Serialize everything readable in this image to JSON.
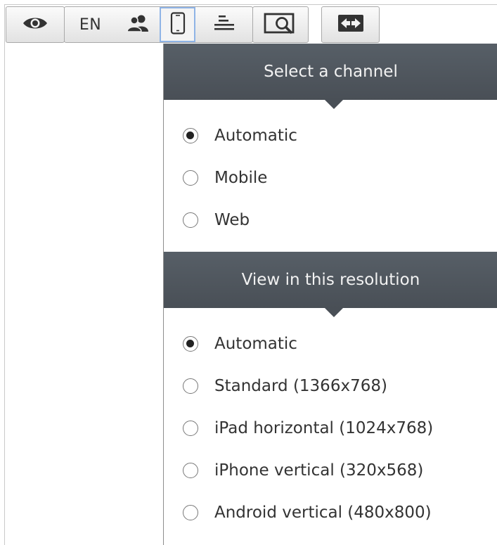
{
  "toolbar": {
    "language_label": "EN",
    "icons": [
      "eye-icon",
      "users-icon",
      "device-icon",
      "list-icon",
      "screen-zoom-icon",
      "resize-horizontal-icon"
    ],
    "active_button": "device-icon"
  },
  "channel_menu": {
    "header": "Select a channel",
    "options": [
      {
        "label": "Automatic",
        "checked": true
      },
      {
        "label": "Mobile",
        "checked": false
      },
      {
        "label": "Web",
        "checked": false
      }
    ]
  },
  "resolution_menu": {
    "header": "View in this resolution",
    "options": [
      {
        "label": "Automatic",
        "checked": true
      },
      {
        "label": "Standard (1366x768)",
        "checked": false
      },
      {
        "label": "iPad horizontal (1024x768)",
        "checked": false
      },
      {
        "label": "iPhone vertical (320x568)",
        "checked": false
      },
      {
        "label": "Android vertical (480x800)",
        "checked": false
      }
    ]
  },
  "colors": {
    "header_bg": "#4f555c",
    "header_text": "#f2f2f2",
    "active_outline": "#8fb4e6"
  }
}
